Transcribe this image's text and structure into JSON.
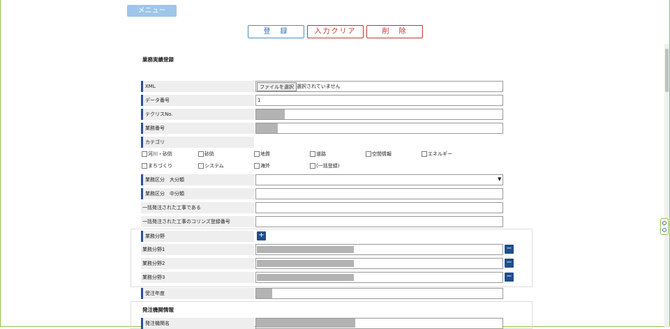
{
  "header": {
    "menu_label": "メニュー"
  },
  "actions": {
    "register": "登　録",
    "clear": "入力クリア",
    "delete": "削　除"
  },
  "section_title": "業務実績登録",
  "fields": {
    "xml": {
      "label": "XML",
      "file_button": "ファイルを選択",
      "file_status": "選択されていません"
    },
    "data_no": {
      "label": "データ番号",
      "value": "1"
    },
    "techris_no": {
      "label": "テクリスNo."
    },
    "business_no": {
      "label": "業務番号"
    },
    "category": {
      "label": "カテゴリ"
    }
  },
  "categories": [
    "河川・砂防",
    "砂防",
    "地質",
    "道路",
    "空間情報",
    "エネルギー",
    "まちづくり",
    "システム",
    "海外",
    "(一括登録)"
  ],
  "classification": {
    "major": {
      "label": "業務区分　大分類"
    },
    "middle": {
      "label": "業務区分　中分類"
    },
    "bulk_order": {
      "label": "一括発注された工事である"
    },
    "bulk_corins": {
      "label": "一括発注された工事のコリンズ登録番号"
    }
  },
  "business_fields": {
    "label": "業務分野",
    "add_label": "+",
    "remove_label": "−",
    "items": [
      "業務分野1",
      "業務分野2",
      "業務分野3"
    ]
  },
  "order_year": {
    "label": "受注年度"
  },
  "client_section": {
    "title": "発注機関情報",
    "name_label": "発注機関名"
  }
}
